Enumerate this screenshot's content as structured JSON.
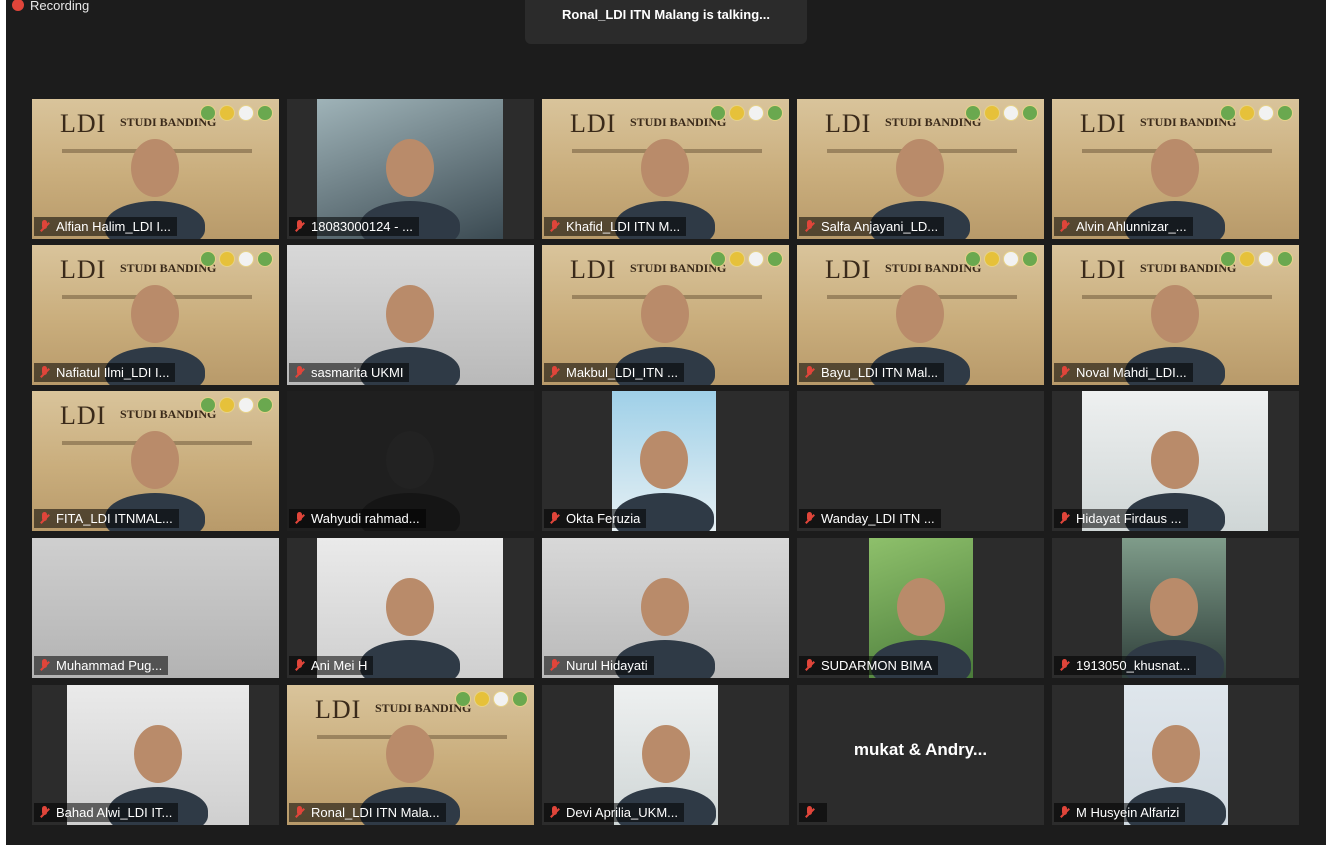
{
  "recording": {
    "label": "Recording"
  },
  "talking_banner": "Ronal_LDI ITN Malang is talking...",
  "participants": [
    {
      "name": "Alfian Halim_LDI I...",
      "bg": "banner"
    },
    {
      "name": "18083000124 - ...",
      "bg": "photo"
    },
    {
      "name": "Khafid_LDI ITN M...",
      "bg": "banner"
    },
    {
      "name": "Salfa Anjayani_LD...",
      "bg": "banner"
    },
    {
      "name": "Alvin Ahlunnizar_...",
      "bg": "banner"
    },
    {
      "name": "Nafiatul Ilmi_LDI I...",
      "bg": "banner"
    },
    {
      "name": "sasmarita UKMI",
      "bg": "photo"
    },
    {
      "name": "Makbul_LDI_ITN ...",
      "bg": "banner"
    },
    {
      "name": "Bayu_LDI ITN Mal...",
      "bg": "banner"
    },
    {
      "name": "Noval Mahdi_LDI...",
      "bg": "banner"
    },
    {
      "name": "FITA_LDI ITNMAL...",
      "bg": "banner"
    },
    {
      "name": "Wahyudi rahmad...",
      "bg": "dark"
    },
    {
      "name": "Okta Feruzia",
      "bg": "photo"
    },
    {
      "name": "Wanday_LDI ITN ...",
      "bg": "empty"
    },
    {
      "name": "Hidayat Firdaus ...",
      "bg": "photo"
    },
    {
      "name": "Muhammad Pug...",
      "bg": "gray"
    },
    {
      "name": "Ani Mei H",
      "bg": "photo"
    },
    {
      "name": "Nurul Hidayati",
      "bg": "photo"
    },
    {
      "name": "SUDARMON BIMA",
      "bg": "photo"
    },
    {
      "name": "1913050_khusnat...",
      "bg": "photo"
    },
    {
      "name": "Bahad Alwi_LDI IT...",
      "bg": "photo"
    },
    {
      "name": "Ronal_LDI ITN Mala...",
      "bg": "banner"
    },
    {
      "name": "Devi Aprilia_UKM...",
      "bg": "photo"
    },
    {
      "name": "",
      "bg": "empty",
      "center_label": "mukat & Andry..."
    },
    {
      "name": "M Husyein Alfarizi",
      "bg": "photo"
    }
  ],
  "banner_text": {
    "ldi": "LDI",
    "studi": "STUDI BANDING"
  },
  "colors": {
    "background": "#1c1c1c",
    "tile": "#2c2c2c",
    "muted_mic": "#e0453a"
  }
}
